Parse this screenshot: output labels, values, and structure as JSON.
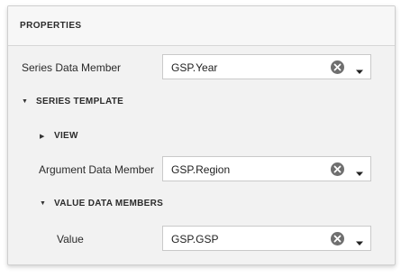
{
  "panel": {
    "title": "PROPERTIES"
  },
  "rows": {
    "series_data_member": {
      "label": "Series Data Member",
      "value": "GSP.Year"
    },
    "argument_data_member": {
      "label": "Argument Data Member",
      "value": "GSP.Region"
    },
    "value": {
      "label": "Value",
      "value": "GSP.GSP"
    }
  },
  "sections": {
    "series_template": {
      "label": "SERIES TEMPLATE",
      "state": "expanded"
    },
    "view": {
      "label": "VIEW",
      "state": "collapsed"
    },
    "value_data_members": {
      "label": "VALUE DATA MEMBERS",
      "state": "expanded"
    }
  },
  "icons": {
    "clear": "clear-circle-icon",
    "dropdown": "dropdown-arrow-icon",
    "expand": "triangle-down-icon",
    "collapse": "triangle-right-icon"
  },
  "colors": {
    "panel_bg": "#f2f2f2",
    "header_bg": "#f7f7f7",
    "input_border": "#c9c9c9",
    "icon": "#6f6f6f"
  }
}
